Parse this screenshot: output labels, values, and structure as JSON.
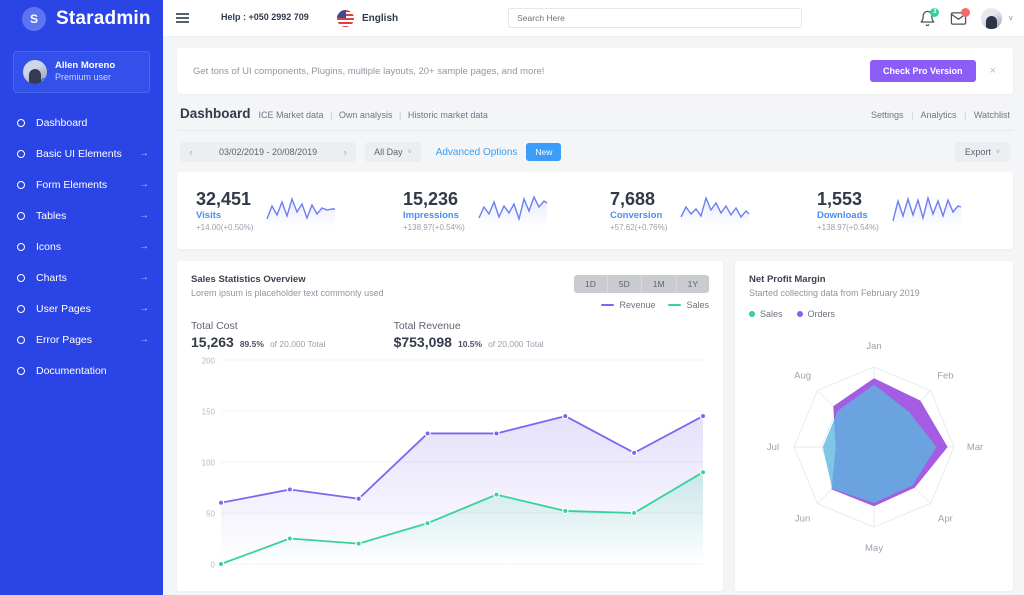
{
  "sidebar": {
    "brand": {
      "initial": "S",
      "name": "Staradmin"
    },
    "profile": {
      "name": "Allen Moreno",
      "role": "Premium user"
    },
    "items": [
      {
        "label": "Dashboard",
        "arrow": ""
      },
      {
        "label": "Basic UI Elements",
        "arrow": "→"
      },
      {
        "label": "Form Elements",
        "arrow": "→"
      },
      {
        "label": "Tables",
        "arrow": "→"
      },
      {
        "label": "Icons",
        "arrow": "→"
      },
      {
        "label": "Charts",
        "arrow": "→"
      },
      {
        "label": "User Pages",
        "arrow": "→"
      },
      {
        "label": "Error Pages",
        "arrow": "→"
      },
      {
        "label": "Documentation",
        "arrow": ""
      }
    ]
  },
  "topbar": {
    "help": "Help : +050 2992 709",
    "language": "English",
    "search_placeholder": "Search Here",
    "notification_count": "3",
    "message_count": ""
  },
  "promo": {
    "text": "Get tons of UI components, Plugins, multiple layouts, 20+ sample pages, and more!",
    "button": "Check Pro Version",
    "close": "×",
    "accent": "#8b5cf6"
  },
  "pagehead": {
    "title": "Dashboard",
    "crumbs": [
      "ICE Market data",
      "Own analysis",
      "Historic market data"
    ],
    "links": [
      "Settings",
      "Analytics",
      "Watchlist"
    ]
  },
  "toolbar": {
    "prev": "‹",
    "next": "›",
    "date_range": "03/02/2019 - 20/08/2019",
    "all_day": "All Day",
    "advanced_options": "Advanced Options",
    "new_badge": "New",
    "export": "Export",
    "caret": "˅"
  },
  "stats": [
    {
      "value": "32,451",
      "label": "Visits",
      "delta": "+14.00(+0.50%)"
    },
    {
      "value": "15,236",
      "label": "Impressions",
      "delta": "+138.97(+0.54%)"
    },
    {
      "value": "7,688",
      "label": "Conversion",
      "delta": "+57.62(+0.76%)"
    },
    {
      "value": "1,553",
      "label": "Downloads",
      "delta": "+138.97(+0.54%)"
    }
  ],
  "sales_card": {
    "title": "Sales Statistics Overview",
    "subtitle": "Lorem ipsum is placeholder text commonly used",
    "ranges": [
      "1D",
      "5D",
      "1M",
      "1Y"
    ],
    "active_range": "1Y",
    "total_cost_label": "Total Cost",
    "total_cost_value": "15,263",
    "total_cost_pct": "89.5%",
    "total_cost_of": "of 20,000 Total",
    "total_revenue_label": "Total Revenue",
    "total_revenue_value": "$753,098",
    "total_revenue_pct": "10.5%",
    "total_revenue_of": "of 20,000 Total"
  },
  "profit_card": {
    "title": "Net Profit Margin",
    "subtitle": "Started collecting data from February 2019",
    "legend": [
      {
        "label": "Sales",
        "color": "#32d296"
      },
      {
        "label": "Orders",
        "color": "#8b5cf6"
      }
    ]
  },
  "chart_data": [
    {
      "type": "line",
      "title": "Sales Statistics Overview",
      "xlabel": "",
      "ylabel": "",
      "ylim": [
        0,
        200
      ],
      "yticks": [
        0,
        50,
        100,
        150,
        200
      ],
      "grid": true,
      "legend_position": "top-right",
      "x": [
        1,
        2,
        3,
        4,
        5,
        6,
        7,
        8
      ],
      "series": [
        {
          "name": "Revenue",
          "color": "#7b68ee",
          "values": [
            60,
            73,
            64,
            128,
            128,
            145,
            109,
            145
          ]
        },
        {
          "name": "Sales",
          "color": "#37d39b",
          "values": [
            0,
            25,
            20,
            40,
            68,
            52,
            50,
            90
          ]
        }
      ]
    },
    {
      "type": "radar",
      "title": "Net Profit Margin",
      "categories": [
        "Jan",
        "Feb",
        "Mar",
        "Apr",
        "May",
        "Jun",
        "Jul",
        "Aug"
      ],
      "rmax": 100,
      "series": [
        {
          "name": "Orders",
          "color": "#9b4ee0",
          "values": [
            86,
            82,
            92,
            72,
            74,
            75,
            48,
            72
          ]
        },
        {
          "name": "Sales",
          "color": "#5bb7e0",
          "values": [
            78,
            62,
            78,
            68,
            70,
            74,
            64,
            64
          ]
        }
      ]
    },
    {
      "type": "line",
      "title": "Visits sparkline",
      "values": [
        12,
        34,
        18,
        40,
        16,
        44,
        22,
        38,
        14,
        36,
        20,
        30,
        26,
        28,
        27
      ]
    },
    {
      "type": "line",
      "title": "Impressions sparkline",
      "values": [
        14,
        30,
        20,
        40,
        18,
        34,
        22,
        36,
        16,
        44,
        26,
        48,
        30,
        42,
        38
      ]
    },
    {
      "type": "line",
      "title": "Conversion sparkline",
      "values": [
        16,
        32,
        20,
        28,
        18,
        46,
        30,
        38,
        24,
        34,
        20,
        30,
        18,
        26,
        22
      ]
    },
    {
      "type": "line",
      "title": "Downloads sparkline",
      "values": [
        10,
        40,
        18,
        44,
        20,
        42,
        16,
        46,
        22,
        40,
        18,
        44,
        24,
        34,
        32
      ]
    }
  ]
}
